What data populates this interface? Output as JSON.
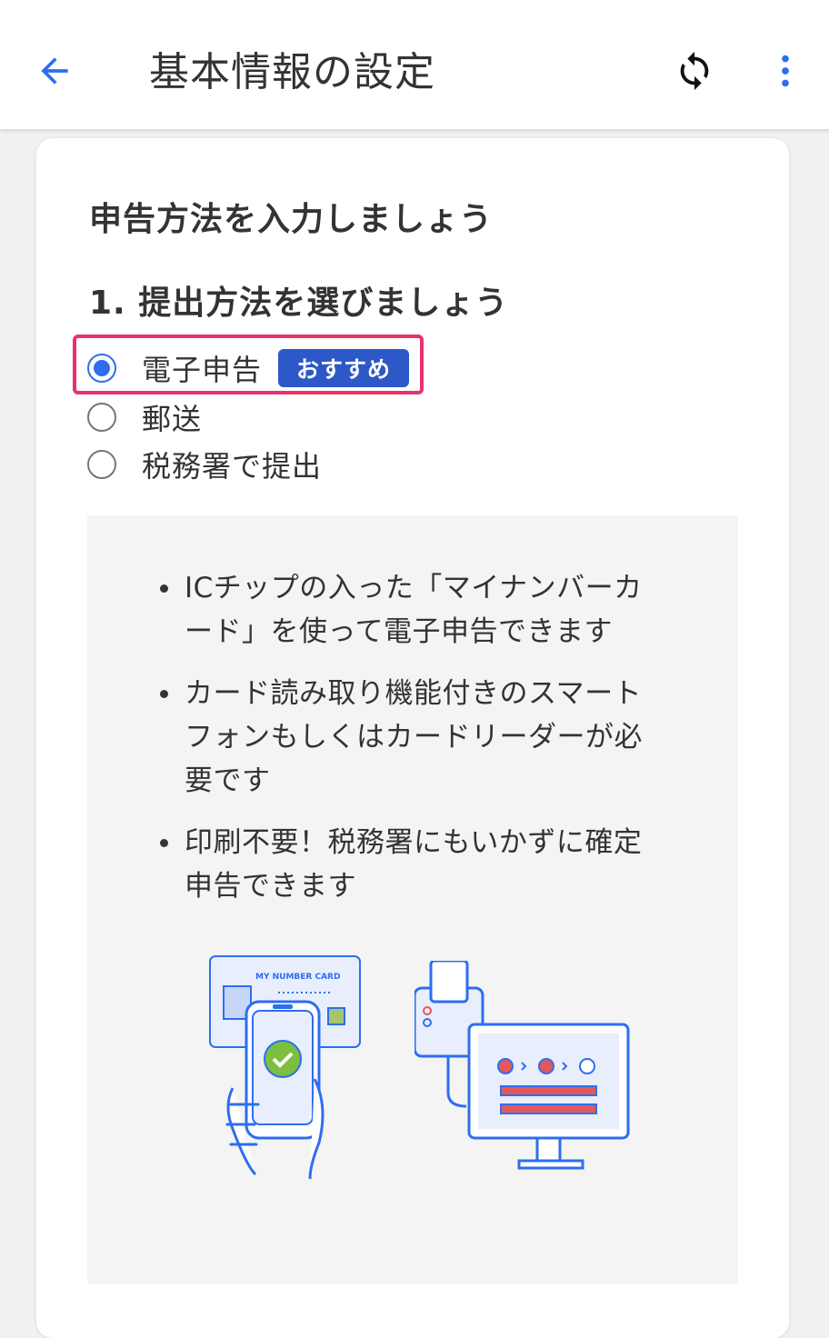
{
  "header": {
    "title": "基本情報の設定",
    "back_icon": "arrow-left-icon",
    "sync_icon": "sync-icon",
    "more_icon": "more-vertical-icon"
  },
  "card": {
    "heading": "申告方法を入力しましょう",
    "step_heading": "1. 提出方法を選びましょう",
    "options": [
      {
        "label": "電子申告",
        "badge": "おすすめ",
        "selected": true
      },
      {
        "label": "郵送",
        "selected": false
      },
      {
        "label": "税務署で提出",
        "selected": false
      }
    ],
    "info": {
      "bullets": [
        "ICチップの入った「マイナンバーカード」を使って電子申告できます",
        "カード読み取り機能付きのスマートフォンもしくはカードリーダーが必要です",
        "印刷不要！税務署にもいかずに確定申告できます"
      ],
      "card_text": "MY NUMBER CARD"
    }
  },
  "colors": {
    "accent": "#2d6ef0",
    "badge": "#2d58c8",
    "highlight": "#e8336a",
    "illustration_blue": "#2d6ef0",
    "illustration_red": "#e05a5a",
    "check_green": "#7cbf3f"
  }
}
